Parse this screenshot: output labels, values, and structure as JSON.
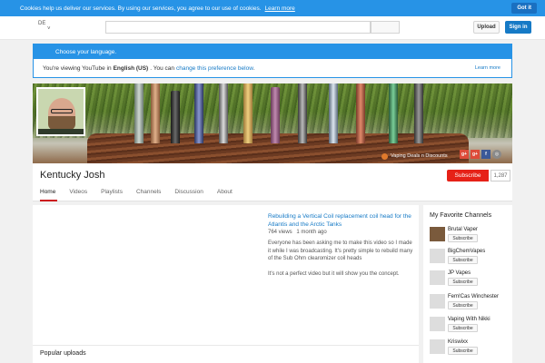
{
  "cookie_bar": {
    "message": "Cookies help us deliver our services. By using our services, you agree to our use of cookies.",
    "learn_more": "Learn more",
    "got_it": "Got it"
  },
  "masthead": {
    "region_label": "DE",
    "upload": "Upload",
    "sign_in": "Sign in"
  },
  "language_notice": {
    "title": "Choose your language.",
    "prefix": "You're viewing YouTube in",
    "language": "English (US)",
    "middle": ". You can",
    "link": "change this preference below",
    "suffix": ".",
    "learn_more": "Learn more"
  },
  "banner": {
    "link_text": "Vaping Deals n Discounts",
    "social_icons": [
      "google-plus-icon",
      "google-plus-icon",
      "facebook-icon",
      "website-icon"
    ]
  },
  "channel": {
    "name": "Kentucky Josh",
    "subscribe_label": "Subscribe",
    "subscriber_count": "1,287",
    "tabs": [
      "Home",
      "Videos",
      "Playlists",
      "Channels",
      "Discussion",
      "About"
    ],
    "active_tab": "Home"
  },
  "featured_video": {
    "title": "Rebuilding a Vertical Coil replacement coil head for the Atlantis and the Arctic Tanks",
    "views": "764 views",
    "age": "1 month ago",
    "description_1": "Everyone has been asking me to make this video so I made it while I was broadcasting. It's pretty simple to rebuild many of the Sub Ohm clearomizer coil heads",
    "description_2": "It's not a perfect video but it will show you the concept."
  },
  "popular_uploads": {
    "title": "Popular uploads"
  },
  "favorite_channels": {
    "title": "My Favorite Channels",
    "subscribe_label": "Subscribe",
    "items": [
      {
        "name": "Brutal Vaper"
      },
      {
        "name": "BigChemVapes"
      },
      {
        "name": "JP Vapes"
      },
      {
        "name": "Fem!Cas Winchester"
      },
      {
        "name": "Vaping With Nikki"
      },
      {
        "name": "Kriswixx"
      }
    ]
  },
  "colors": {
    "accent_blue": "#2793e6",
    "subscribe_red": "#e62117",
    "link_blue": "#167ac6"
  }
}
